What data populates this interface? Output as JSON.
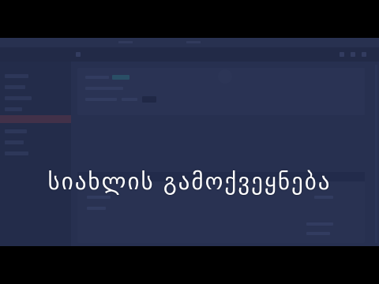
{
  "overlay": {
    "headline": "სიახლის გამოქვეყნება"
  },
  "colors": {
    "letterbox": "#000000",
    "overlay_tint": "#262f4e",
    "text": "#ffffff"
  },
  "background_ui": {
    "sidebar_active_color": "#5a3346",
    "accent_button_color": "#2e6a7a"
  }
}
